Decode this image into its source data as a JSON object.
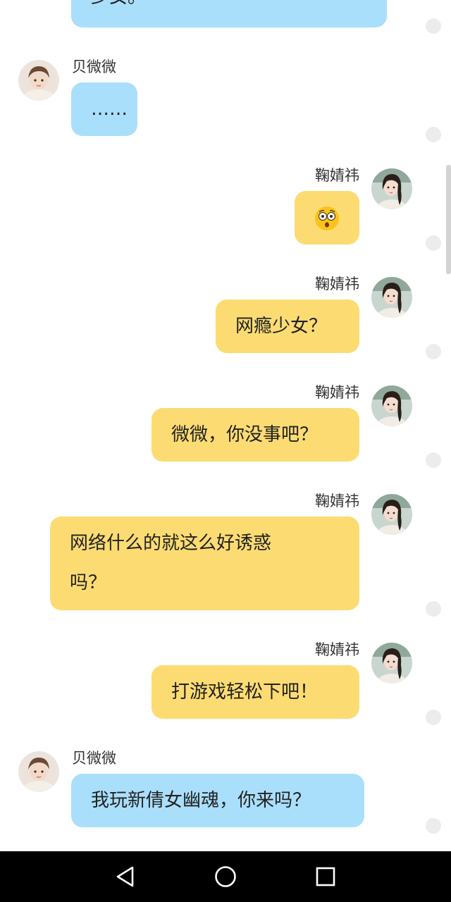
{
  "messages": [
    {
      "side": "left",
      "name": "",
      "text": "少女。"
    },
    {
      "side": "left",
      "name": "贝微微",
      "text": "……"
    },
    {
      "side": "right",
      "name": "鞠婧祎",
      "text": "",
      "emoji": "astonished-face-emoji"
    },
    {
      "side": "right",
      "name": "鞠婧祎",
      "text": "网瘾少女？"
    },
    {
      "side": "right",
      "name": "鞠婧祎",
      "text": "微微，你没事吧？"
    },
    {
      "side": "right",
      "name": "鞠婧祎",
      "line1": "网络什么的就这么好诱惑",
      "line2": "吗？"
    },
    {
      "side": "right",
      "name": "鞠婧祎",
      "text": "打游戏轻松下吧！"
    },
    {
      "side": "left",
      "name": "贝微微",
      "text": "我玩新倩女幽魂，你来吗？"
    }
  ],
  "navbar": {
    "back_icon": "back-triangle-icon",
    "home_icon": "home-circle-icon",
    "recents_icon": "recents-square-icon"
  },
  "colors": {
    "left_bubble": "#aadffb",
    "right_bubble": "#fcdc72",
    "navbar": "#000000"
  }
}
